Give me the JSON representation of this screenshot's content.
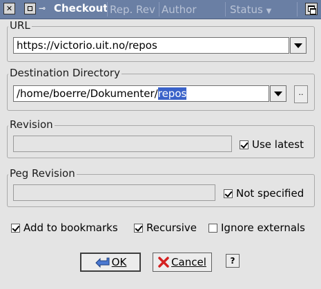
{
  "titlebar": {
    "title": "Checkout",
    "background_columns": [
      "Rep. Rev",
      "Author",
      "Status"
    ]
  },
  "url_group": {
    "label": "URL",
    "value": "https://victorio.uit.no/repos"
  },
  "destination_group": {
    "label": "Destination Directory",
    "value_prefix": "/home/boerre/Dokumenter/",
    "value_selected": "repos",
    "browse_label": ".."
  },
  "revision_group": {
    "label": "Revision",
    "value": "",
    "use_latest_label": "Use latest",
    "use_latest_checked": true
  },
  "peg_revision_group": {
    "label": "Peg Revision",
    "value": "",
    "not_specified_label": "Not specified",
    "not_specified_checked": true
  },
  "options": {
    "add_to_bookmarks_label": "Add to bookmarks",
    "add_to_bookmarks_checked": true,
    "recursive_label": "Recursive",
    "recursive_checked": true,
    "ignore_externals_label": "Ignore externals",
    "ignore_externals_checked": false
  },
  "buttons": {
    "ok_label": "OK",
    "cancel_label": "Cancel",
    "help_label": "?"
  },
  "colors": {
    "titlebar_bg": "#6a7fa4",
    "selection_bg": "#3a62c9",
    "dialog_bg": "#e4e4e4",
    "cancel_icon": "#d42020",
    "ok_icon": "#4a78d0"
  },
  "icons": {
    "close": "close-icon",
    "window_menu": "window-menu-icon",
    "pin": "pin-icon",
    "maximize": "maximize-icon",
    "ok": "ok-arrow-icon",
    "cancel": "cancel-x-icon"
  }
}
